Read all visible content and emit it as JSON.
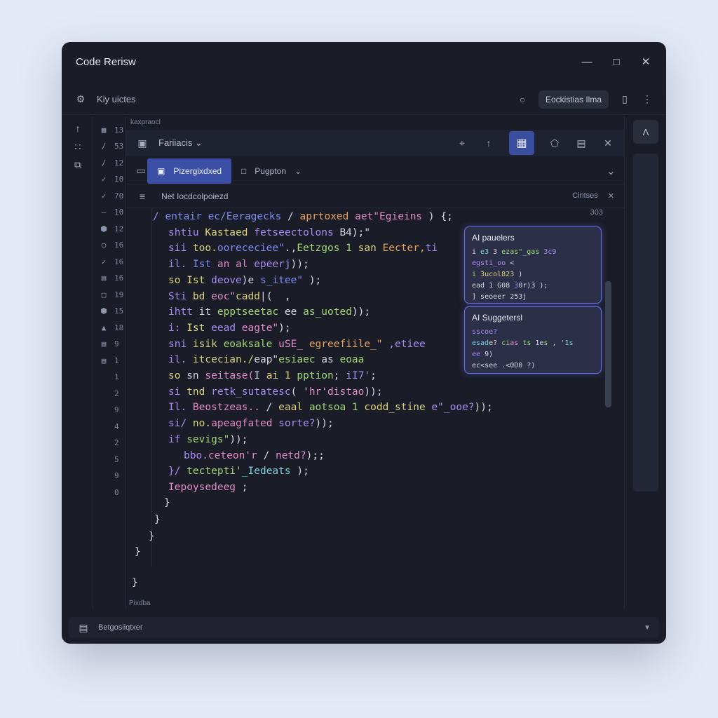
{
  "window": {
    "title": "Code Rerisw"
  },
  "topbar": {
    "label": "Kiy uictes",
    "pill": "Eockistias Ilma"
  },
  "editor": {
    "crumb": "kaxpraocl",
    "file_label": "Fariiacis",
    "tabs": [
      {
        "label": "Pizergixdxed"
      },
      {
        "label": "Pugpton"
      }
    ],
    "panel_title": "Net Iocdcolpoiezd",
    "panel_right": "Cintses",
    "minimap_label": "303",
    "status": "Pixdba"
  },
  "gutter": {
    "numbers": [
      "13",
      "53",
      "12",
      "10",
      "70",
      "10",
      "12",
      "16",
      "16",
      "16",
      "19",
      "15",
      "18",
      "9",
      "1",
      "1",
      "2",
      "9",
      "4",
      "2",
      "5",
      "9",
      "0"
    ]
  },
  "code_lines": [
    {
      "indent": 0,
      "tokens": [
        [
          "/ ",
          "c-violet"
        ],
        [
          "entair ec/Eeragecks",
          "c-blue"
        ],
        [
          " / ",
          "c-white"
        ],
        [
          "aprtoxed",
          "c-orange"
        ],
        [
          " aet\"Egieins",
          "c-pink"
        ],
        [
          " ) {;",
          "c-white"
        ]
      ]
    },
    {
      "indent": 1,
      "tokens": [
        [
          "shtiu ",
          "c-violet"
        ],
        [
          "Kastaed ",
          "c-yellow"
        ],
        [
          "fetseectolons ",
          "c-violet"
        ],
        [
          "B4);\"",
          "c-white"
        ]
      ]
    },
    {
      "indent": 1,
      "tokens": [
        [
          "sii ",
          "c-violet"
        ],
        [
          "too.",
          "c-yellow"
        ],
        [
          "oorececiee\"",
          "c-blue"
        ],
        [
          ".,",
          "c-white"
        ],
        [
          "Eetzgos 1 ",
          "c-green"
        ],
        [
          "san ",
          "c-yellow"
        ],
        [
          "Eecter,",
          "c-orange"
        ],
        [
          "ti",
          "c-violet"
        ]
      ]
    },
    {
      "indent": 1,
      "tokens": [
        [
          "il. ",
          "c-violet"
        ],
        [
          "Ist ",
          "c-blue"
        ],
        [
          "an al ",
          "c-pink"
        ],
        [
          "epeerj",
          "c-violet"
        ],
        [
          "));",
          "c-white"
        ]
      ]
    },
    {
      "indent": 1,
      "tokens": [
        [
          "so ",
          "c-yellow"
        ],
        [
          "Ist ",
          "c-yellow"
        ],
        [
          "deove",
          "c-violet"
        ],
        [
          ")e ",
          "c-white"
        ],
        [
          "s_itee\"",
          "c-blue"
        ],
        [
          " );",
          "c-white"
        ]
      ]
    },
    {
      "indent": 1,
      "tokens": [
        [
          "Sti ",
          "c-violet"
        ],
        [
          "bd ",
          "c-yellow"
        ],
        [
          "eoc\"",
          "c-pink"
        ],
        [
          "cadd",
          "c-yellow"
        ],
        [
          "|(  ,",
          "c-white"
        ]
      ]
    },
    {
      "indent": 1,
      "tokens": [
        [
          "ihtt ",
          "c-violet"
        ],
        [
          "it ",
          "c-white"
        ],
        [
          "epptseetac ",
          "c-green"
        ],
        [
          "ee ",
          "c-white"
        ],
        [
          "as_uoted",
          "c-green"
        ],
        [
          "));",
          "c-white"
        ]
      ]
    },
    {
      "indent": 1,
      "tokens": [
        [
          "i: ",
          "c-violet"
        ],
        [
          "Ist ",
          "c-yellow"
        ],
        [
          "eead ",
          "c-violet"
        ],
        [
          "eagte\"",
          "c-pink"
        ],
        [
          ");",
          "c-white"
        ]
      ]
    },
    {
      "indent": 1,
      "tokens": [
        [
          "sni ",
          "c-violet"
        ],
        [
          "isik ",
          "c-yellow"
        ],
        [
          "eoaksale ",
          "c-green"
        ],
        [
          "uSE_ ",
          "c-pink"
        ],
        [
          "egreefiile_\"",
          "c-orange"
        ],
        [
          " ,etiee",
          "c-violet"
        ]
      ]
    },
    {
      "indent": 1,
      "tokens": [
        [
          "il. ",
          "c-violet"
        ],
        [
          "itcecian./",
          "c-yellow"
        ],
        [
          "eap\"",
          "c-white"
        ],
        [
          "esiaec ",
          "c-green"
        ],
        [
          "as ",
          "c-white"
        ],
        [
          "eoaa",
          "c-green"
        ]
      ]
    },
    {
      "indent": 1,
      "tokens": [
        [
          "so ",
          "c-yellow"
        ],
        [
          "sn ",
          "c-white"
        ],
        [
          "seitase(",
          "c-pink"
        ],
        [
          "I ",
          "c-white"
        ],
        [
          "ai 1 ",
          "c-yellow"
        ],
        [
          "pption",
          "c-green"
        ],
        [
          "; ",
          "c-white"
        ],
        [
          "iI7'",
          "c-violet"
        ],
        [
          ";",
          "c-white"
        ]
      ]
    },
    {
      "indent": 1,
      "tokens": [
        [
          "si ",
          "c-violet"
        ],
        [
          "tnd ",
          "c-yellow"
        ],
        [
          "retk_sutatesc",
          "c-violet"
        ],
        [
          "( '",
          "c-white"
        ],
        [
          "hr'distao",
          "c-pink"
        ],
        [
          "));",
          "c-white"
        ]
      ]
    },
    {
      "indent": 1,
      "tokens": [
        [
          "Il. ",
          "c-violet"
        ],
        [
          "Beostzeas..",
          "c-pink"
        ],
        [
          " / ",
          "c-white"
        ],
        [
          "eaal ",
          "c-yellow"
        ],
        [
          "aotsoa 1 ",
          "c-green"
        ],
        [
          "codd_stine ",
          "c-yellow"
        ],
        [
          "e\"_ooe?",
          "c-violet"
        ],
        [
          "));",
          "c-white"
        ]
      ]
    },
    {
      "indent": 1,
      "tokens": [
        [
          "si/ ",
          "c-violet"
        ],
        [
          "no.",
          "c-yellow"
        ],
        [
          "apeagfated ",
          "c-pink"
        ],
        [
          "sorte?",
          "c-violet"
        ],
        [
          "));",
          "c-white"
        ]
      ]
    },
    {
      "indent": 1,
      "tokens": [
        [
          "if ",
          "c-violet"
        ],
        [
          "sevigs\"",
          "c-green"
        ],
        [
          "));",
          "c-white"
        ]
      ]
    },
    {
      "indent": 2,
      "tokens": [
        [
          "bbo.",
          "c-violet"
        ],
        [
          "ceteon'r ",
          "c-pink"
        ],
        [
          "/ ",
          "c-white"
        ],
        [
          "netd?",
          "c-pink"
        ],
        [
          ");",
          "c-white"
        ],
        [
          ";",
          "c-white"
        ]
      ]
    },
    {
      "indent": 1,
      "tokens": [
        [
          "}/ ",
          "c-violet"
        ],
        [
          "tectepti'",
          "c-green"
        ],
        [
          "_Iedeats",
          "c-cyan"
        ],
        [
          " );",
          "c-white"
        ]
      ]
    },
    {
      "indent": 1,
      "tokens": [
        [
          "Iepoysedeeg",
          "c-pink"
        ],
        [
          " ;",
          "c-white"
        ]
      ]
    }
  ],
  "closing_braces": [
    "}",
    "}",
    "}",
    "}",
    "}"
  ],
  "ai_panels": [
    {
      "title": "AI pauelers",
      "lines": [
        [
          [
            "i ",
            "c-white"
          ],
          [
            "e3 ",
            "c-cyan"
          ],
          [
            "3 ",
            "c-white"
          ],
          [
            "ezas\"_gas",
            "c-green"
          ],
          [
            " 3c9",
            "c-violet"
          ]
        ],
        [
          [
            "egsti_oo",
            "c-violet"
          ],
          [
            " <",
            "c-white"
          ]
        ],
        [
          [
            "i ",
            "c-green"
          ],
          [
            "3ucol",
            "c-yellow"
          ],
          [
            "823",
            "c-yellow"
          ],
          [
            " )",
            "c-white"
          ]
        ],
        [
          [
            "ead ",
            "c-white"
          ],
          [
            "1 G08",
            "c-white"
          ],
          [
            " 3",
            "c-violet"
          ],
          [
            "0r",
            "c-white"
          ],
          [
            ")3 ",
            "c-white"
          ],
          [
            ");",
            "c-white"
          ]
        ],
        [
          [
            "] ",
            "c-white"
          ],
          [
            "seoeer",
            "c-white"
          ],
          [
            " 253",
            "c-white"
          ],
          [
            "j",
            "c-white"
          ]
        ]
      ]
    },
    {
      "title": "AI Suggetersl",
      "lines": [
        [
          [
            "sscoe?",
            "c-violet"
          ]
        ],
        [
          [
            "esad",
            "c-cyan"
          ],
          [
            "e?",
            "c-white"
          ],
          [
            " ",
            "c-white"
          ],
          [
            "ci",
            "c-green"
          ],
          [
            "as",
            "c-pink"
          ],
          [
            " ",
            "c-white"
          ],
          [
            "ts",
            "c-green"
          ],
          [
            " 1e",
            "c-white"
          ],
          [
            "s",
            "c-green"
          ],
          [
            " ,",
            "c-white"
          ],
          [
            " '1s",
            "c-cyan"
          ]
        ],
        [
          [
            "ee ",
            "c-violet"
          ],
          [
            "9",
            "c-white"
          ],
          [
            ")",
            "c-white"
          ]
        ],
        [
          [
            "ec",
            "c-white"
          ],
          [
            "<s",
            "c-white"
          ],
          [
            "ee",
            "c-white"
          ],
          [
            " .",
            "c-white"
          ],
          [
            "<0D",
            "c-white"
          ],
          [
            "0 ",
            "c-white"
          ],
          [
            "?",
            "c-white"
          ],
          [
            ")",
            "c-white"
          ]
        ]
      ]
    }
  ],
  "bottombar": {
    "label": "Betgosiiqtxer"
  },
  "colors": {
    "accent": "#3c4fa6",
    "ai_border": "#6a6ff0",
    "window_bg": "#1a1d27"
  }
}
